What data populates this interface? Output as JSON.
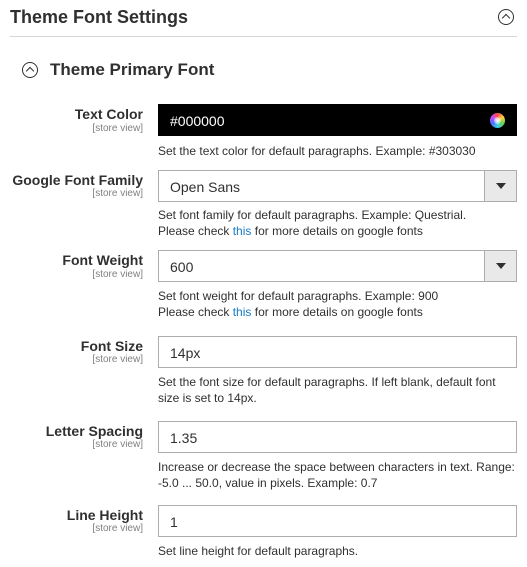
{
  "section": {
    "title": "Theme Font Settings"
  },
  "group": {
    "title": "Theme Primary Font"
  },
  "fields": [
    {
      "label": "Text Color",
      "scope": "[store view]",
      "value": "#000000",
      "note": "Set the text color for default paragraphs. Example: #303030",
      "swatch_icon": "color-wheel-icon",
      "background_color": "#000000"
    },
    {
      "label": "Google Font Family",
      "scope": "[store view]",
      "value": "Open Sans",
      "note_line1": "Set font family for default paragraphs. Example: Questrial.",
      "note_prefix": "Please check ",
      "note_link": "this",
      "note_suffix": " for more details on google fonts"
    },
    {
      "label": "Font Weight",
      "scope": "[store view]",
      "value": "600",
      "note_line1": "Set font weight for default paragraphs. Example: 900",
      "note_prefix": "Please check ",
      "note_link": "this",
      "note_suffix": " for more details on google fonts"
    },
    {
      "label": "Font Size",
      "scope": "[store view]",
      "value": "14px",
      "note": "Set the font size for default paragraphs. If left blank, default font size is set to 14px."
    },
    {
      "label": "Letter Spacing",
      "scope": "[store view]",
      "value": "1.35",
      "note": "Increase or decrease the space between characters in text. Range: -5.0 ... 50.0, value in pixels. Example: 0.7"
    },
    {
      "label": "Line Height",
      "scope": "[store view]",
      "value": "1",
      "note": "Set line height for default paragraphs."
    }
  ],
  "colors": {
    "link": "#1979c3",
    "text": "#303030",
    "scope": "#808080",
    "border": "#adadad"
  }
}
